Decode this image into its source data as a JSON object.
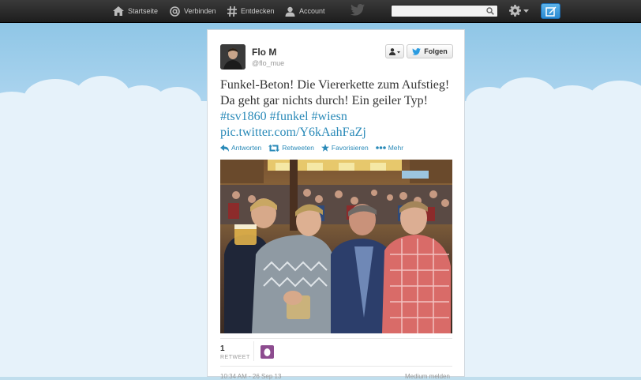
{
  "topbar": {
    "nav": [
      {
        "label": "Startseite",
        "icon": "home-icon"
      },
      {
        "label": "Verbinden",
        "icon": "at-icon"
      },
      {
        "label": "Entdecken",
        "icon": "hash-icon"
      },
      {
        "label": "Account",
        "icon": "person-icon"
      }
    ],
    "search": {
      "value": "",
      "placeholder": ""
    }
  },
  "tweet": {
    "author_name": "Flo M",
    "author_handle": "@flo_mue",
    "follow_label": "Folgen",
    "text": "Funkel-Beton! Die Viererkette zum Aufstieg! Da geht gar nichts durch! Ein geiler Typ!",
    "hashtags": [
      "#tsv1860",
      "#funkel",
      "#wiesn"
    ],
    "link": "pic.twitter.com/Y6kAahFaZj",
    "actions": {
      "reply": "Antworten",
      "retweet": "Retweeten",
      "favorite": "Favorisieren",
      "more": "Mehr"
    },
    "retweet_count": "1",
    "retweet_label": "RETWEET",
    "timestamp": "10:34 AM - 26 Sep 13",
    "report_label": "Medium melden"
  },
  "colors": {
    "link": "#2a8ab8",
    "topbar": "#262626",
    "background": "#c0deed"
  }
}
